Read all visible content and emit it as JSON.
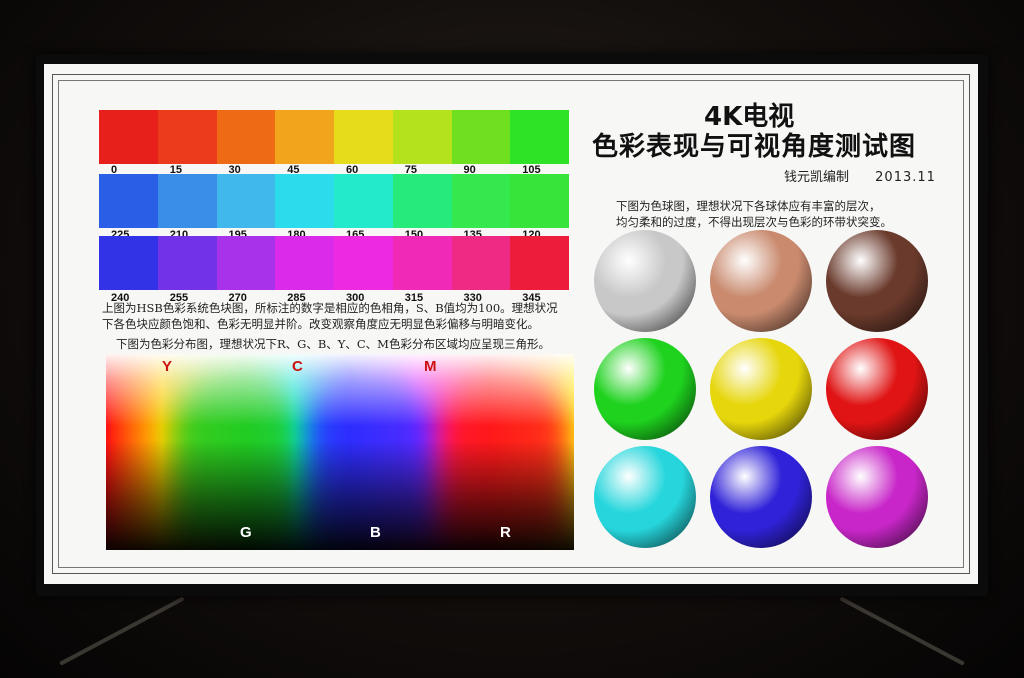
{
  "poster": {
    "title_line1": "4K电视",
    "title_line2": "色彩表现与可视角度测试图",
    "author": "钱元凯编制",
    "date": "2013.11"
  },
  "hue_bars": [
    {
      "labels": [
        "0",
        "15",
        "30",
        "45",
        "60",
        "75",
        "90",
        "105"
      ],
      "colors": [
        "#e8201c",
        "#ec3a1c",
        "#ee6a14",
        "#f1a51c",
        "#e6dc1c",
        "#b4e21c",
        "#6ee020",
        "#2ee226"
      ]
    },
    {
      "labels": [
        "225",
        "210",
        "195",
        "180",
        "165",
        "150",
        "135",
        "120"
      ],
      "colors": [
        "#2a5ee6",
        "#3a8ee8",
        "#40b8ec",
        "#2cdcec",
        "#24eacc",
        "#26ea7a",
        "#34e84e",
        "#36e43a"
      ]
    },
    {
      "labels": [
        "240",
        "255",
        "270",
        "285",
        "300",
        "315",
        "330",
        "345"
      ],
      "colors": [
        "#3232e6",
        "#7232e8",
        "#a832ea",
        "#dc2aea",
        "#ee2ae0",
        "#f02ab6",
        "#ee2a84",
        "#ec1c3a"
      ]
    }
  ],
  "text": {
    "hsb_note_line1": "上图为HSB色彩系统色块图，所标注的数字是相应的色相角，S、B值均为100。理想状况",
    "hsb_note_line2": "下各色块应颜色饱和、色彩无明显并阶。改变观察角度应无明显色彩偏移与明暗变化。",
    "dist_note": "下图为色彩分布图，理想状况下R、G、B、Y、C、M色彩分布区域均应呈现三角形。",
    "sphere_note_line1": "下图为色球图，理想状况下各球体应有丰富的层次，",
    "sphere_note_line2": "均匀柔和的过度，不得出现层次与色彩的环带状突变。"
  },
  "distribution": {
    "top_labels": [
      "Y",
      "C",
      "M"
    ],
    "bottom_labels": [
      "G",
      "B",
      "R"
    ],
    "label_color": "#cc1111",
    "bottom_label_color": "#ffffff"
  },
  "spheres": [
    "#c8c8c8",
    "#c98a6e",
    "#6a3a2c",
    "#1ed21e",
    "#e6d60c",
    "#e01414",
    "#26d6dc",
    "#3022d8",
    "#c826c8"
  ]
}
